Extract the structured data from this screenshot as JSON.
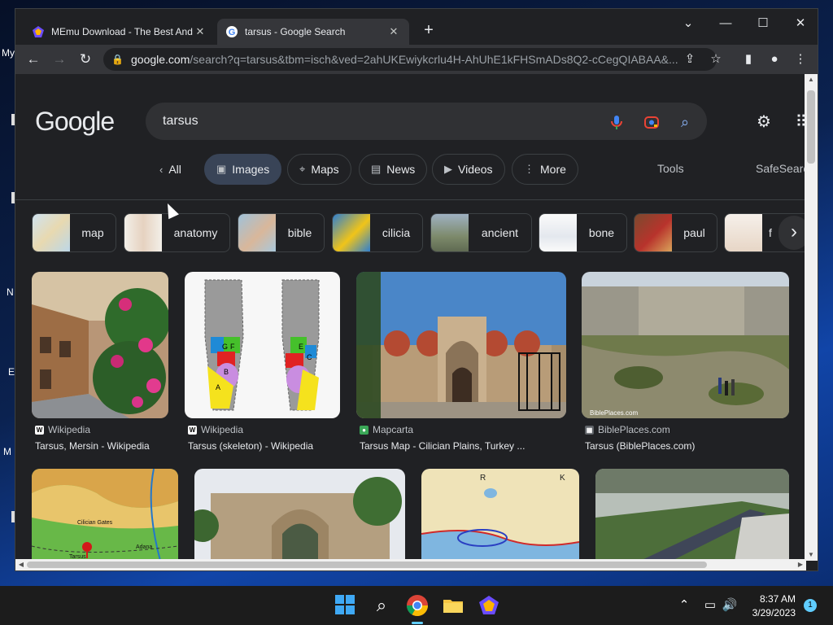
{
  "desktop": {
    "icon_labels": [
      "My",
      "N",
      "E",
      "M"
    ]
  },
  "tabs": [
    {
      "title": "MEmu Download - The Best Andr",
      "favicon": "memu-icon",
      "active": false
    },
    {
      "title": "tarsus - Google Search",
      "favicon": "google-icon",
      "active": true
    }
  ],
  "window_controls": {
    "chevron": "⌄",
    "minimize": "—",
    "maximize": "☐",
    "close": "✕"
  },
  "toolbar": {
    "url_host": "google.com",
    "url_rest": "/search?q=tarsus&tbm=isch&ved=2ahUKEwiykcrlu4H-AhUhE1kFHSmADs8Q2-cCegQIABAA&..."
  },
  "google": {
    "logo_text": "Google",
    "search_value": "tarsus"
  },
  "nav_chips": [
    {
      "label": "All",
      "icon": "chevron-left-icon",
      "active": false
    },
    {
      "label": "Images",
      "icon": "image-icon",
      "active": true
    },
    {
      "label": "Maps",
      "icon": "map-pin-icon",
      "active": false
    },
    {
      "label": "News",
      "icon": "news-icon",
      "active": false
    },
    {
      "label": "Videos",
      "icon": "video-icon",
      "active": false
    },
    {
      "label": "More",
      "icon": "more-icon",
      "active": false
    }
  ],
  "nav_extra": {
    "tools": "Tools",
    "safesearch": "SafeSearc"
  },
  "related_searches": [
    "map",
    "anatomy",
    "bible",
    "cilicia",
    "ancient",
    "bone",
    "paul",
    "f"
  ],
  "results": [
    {
      "source": "Wikipedia",
      "title": "Tarsus, Mersin - Wikipedia",
      "source_icon": "wikipedia-icon"
    },
    {
      "source": "Wikipedia",
      "title": "Tarsus (skeleton) - Wikipedia",
      "source_icon": "wikipedia-icon"
    },
    {
      "source": "Mapcarta",
      "title": "Tarsus Map - Cilician Plains, Turkey ...",
      "source_icon": "mapcarta-icon"
    },
    {
      "source": "BiblePlaces.com",
      "title": "Tarsus (BiblePlaces.com)",
      "source_icon": "bibleplaces-icon"
    }
  ],
  "image_text": {
    "watermark": "BiblePlaces.com",
    "map_labels": [
      "Cilician Gates",
      "Adana",
      "Tarsus"
    ],
    "foot_letters": [
      "G",
      "F",
      "E",
      "C",
      "B",
      "A"
    ],
    "old_map_letters": [
      "R",
      "K"
    ]
  },
  "clock": {
    "time": "8:37 AM",
    "date": "3/29/2023"
  },
  "notification_count": "1",
  "colors": {
    "accent": "#8ab4f8",
    "chip_active": "#394457",
    "taskbar_accent": "#60cdff"
  }
}
